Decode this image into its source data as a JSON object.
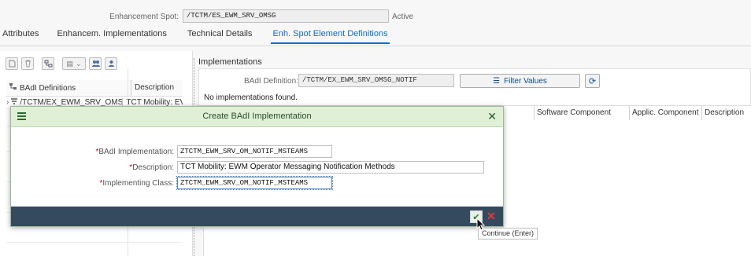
{
  "header": {
    "spot_label": "Enhancement Spot:",
    "spot_value": "/TCTM/ES_EWM_SRV_OMSG",
    "status": "Active"
  },
  "tabs": [
    {
      "label": "Attributes",
      "active": false
    },
    {
      "label": "Enhancem. Implementations",
      "active": false
    },
    {
      "label": "Technical Details",
      "active": false
    },
    {
      "label": "Enh. Spot Element Definitions",
      "active": true
    }
  ],
  "left_panel": {
    "toolbar_icons": [
      "document-icon",
      "trash-icon",
      "hierarchy-icon",
      "dropdown-filter-icon",
      "people-icon",
      "person-icon"
    ],
    "columns": [
      "BAdI Definitions",
      "Description"
    ],
    "rows": [
      {
        "name": "/TCTM/EX_EWM_SRV_OMSG_N",
        "description": "TCT Mobility: EV"
      }
    ]
  },
  "implementations": {
    "title": "Implementations",
    "badi_def_label": "BAdI Definition:",
    "badi_def_value": "/TCTM/EX_EWM_SRV_OMSG_NOTIF",
    "filter_label": "Filter Values",
    "empty_text": "No implementations found.",
    "columns": [
      "Software Component",
      "Applic. Component",
      "Description"
    ]
  },
  "dialog": {
    "title": "Create BAdI Implementation",
    "fields": [
      {
        "label": "BAdI Implementation:",
        "value": "ZTCTM_EWM_SRV_OM_NOTIF_MSTEAMS"
      },
      {
        "label": "Description:",
        "value": "TCT Mobility: EWM Operator Messaging Notification Methods"
      },
      {
        "label": "Implementing Class:",
        "value": "ZTCTM_EWM_SRV_OM_NOTIF_MSTEAMS"
      }
    ],
    "tooltip": "Continue   (Enter)"
  },
  "colors": {
    "accent": "#0a6ed1",
    "dialog_header": "#e0f0d6",
    "dialog_footer": "#354a5f",
    "cancel": "#e13b3b"
  }
}
